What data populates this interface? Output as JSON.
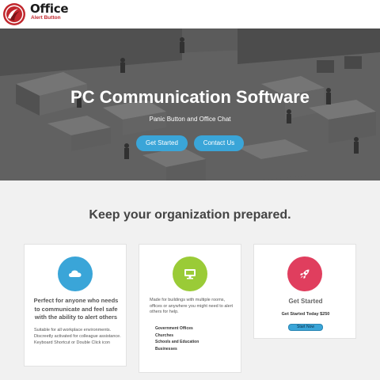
{
  "header": {
    "logo_title": "Office",
    "logo_subtitle": "Alert Button"
  },
  "hero": {
    "title": "PC Communication Software",
    "subtitle": "Panic Button and Office Chat",
    "get_started_label": "Get Started",
    "contact_label": "Contact Us"
  },
  "features": {
    "title": "Keep your organization prepared.",
    "cards": [
      {
        "icon": "cloud-icon",
        "color": "#3aa5d8",
        "heading": "Perfect for anyone who needs to communicate and feel safe with the ability to alert others",
        "body": "Suitable for all workplace environments. Discreetly activated for colleague assistance. Keyboard Shortcut or Double Click icon"
      },
      {
        "icon": "monitor-icon",
        "color": "#9acb37",
        "body": "Made for buildings with multiple rooms, offices or anywhere you might need to alert others for help.",
        "list": [
          "Government Offices",
          "Churches",
          "Schools and Education",
          "Businesses"
        ]
      },
      {
        "icon": "rocket-icon",
        "color": "#e03e5e",
        "heading": "Get Started",
        "subheading": "Get Started Today $250",
        "button_label": "Start Now"
      }
    ]
  }
}
